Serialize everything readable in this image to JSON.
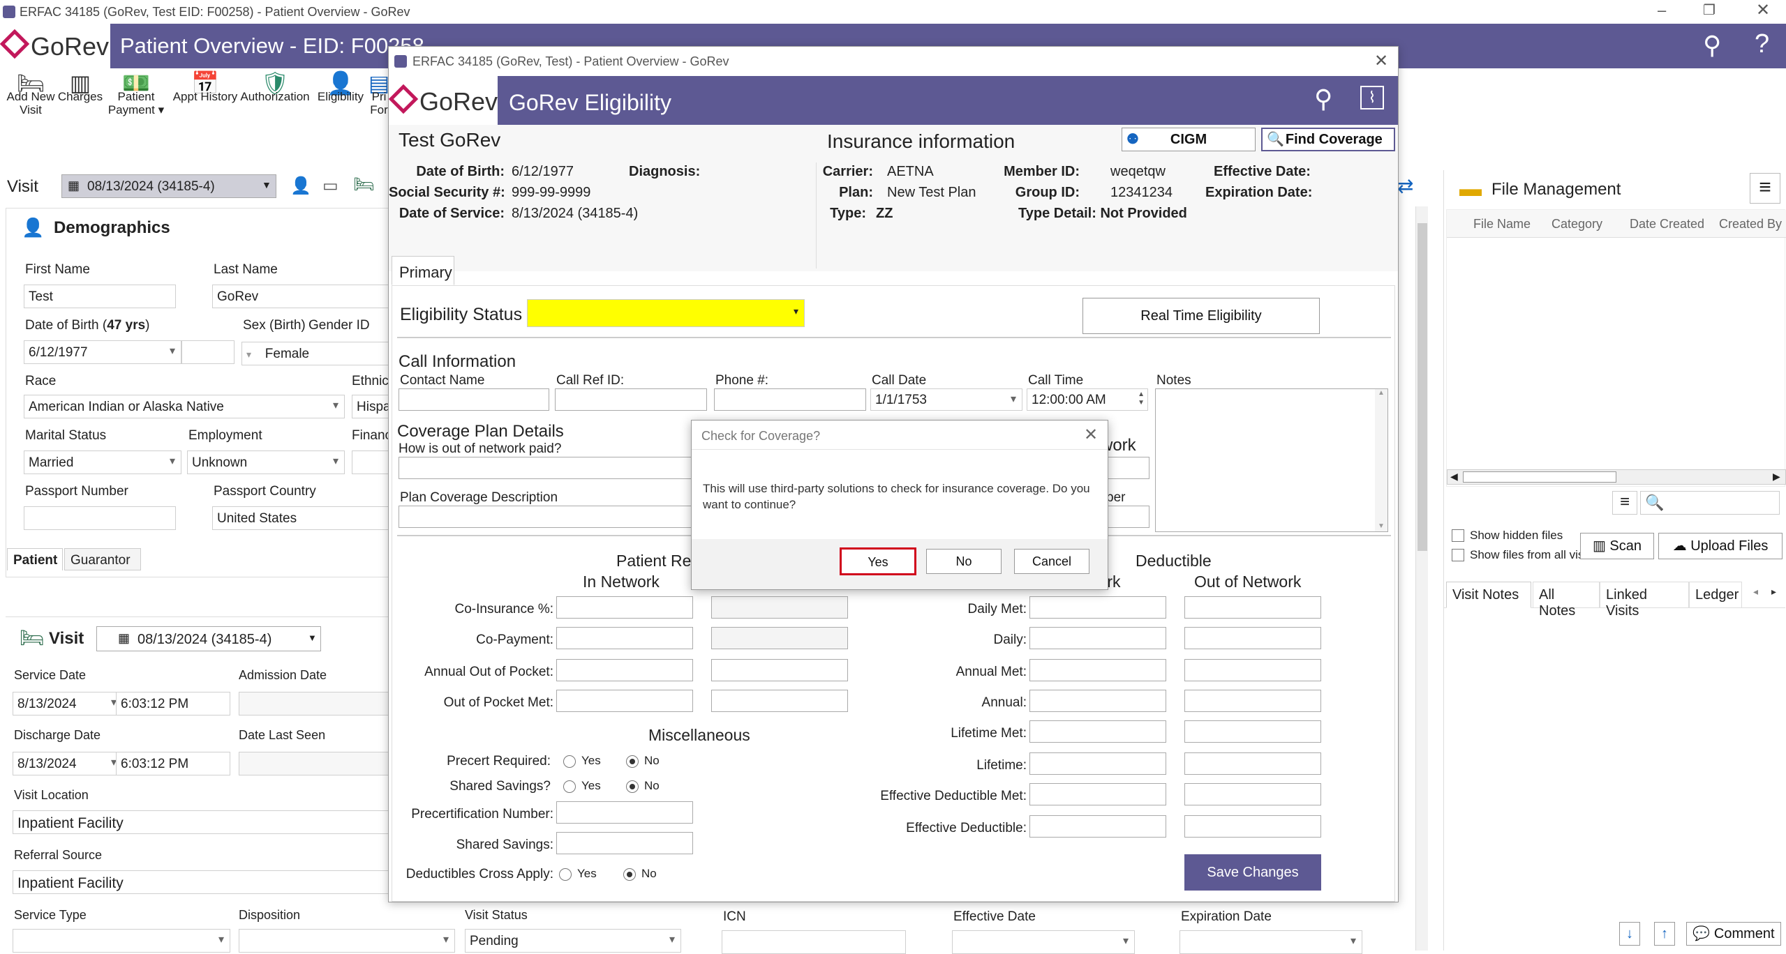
{
  "os_title": "ERFAC 34185 (GoRev, Test EID: F00258) - Patient Overview - GoRev",
  "main": {
    "logo": "GoRev",
    "title": "Patient Overview - EID: F00258"
  },
  "toolbar": [
    "Add New Visit",
    "Charges",
    "Patient Payment",
    "Appt History",
    "Authorization",
    "Eligibility",
    "Pri",
    "For"
  ],
  "visit_bar": {
    "label": "Visit",
    "value": "08/13/2024 (34185-4)"
  },
  "demographics": {
    "title": "Demographics",
    "first_name_label": "First Name",
    "first_name": "Test",
    "last_name_label": "Last Name",
    "last_name": "GoRev",
    "dob_label": "Date of Birth (",
    "dob_age": "47 yrs",
    "dob_close": ")",
    "dob": "6/12/1977",
    "sex_label": "Sex (Birth)",
    "gender_label": "Gender ID",
    "gender": "Female",
    "race_label": "Race",
    "race": "American Indian or Alaska Native",
    "ethnic_label": "Ethnic",
    "ethnic": "Hispa",
    "marital_label": "Marital Status",
    "marital": "Married",
    "employment_label": "Employment",
    "employment": "Unknown",
    "finance_label": "Financ",
    "passport_label": "Passport Number",
    "passport_country_label": "Passport Country",
    "passport_country": "United States",
    "tabs": [
      "Patient",
      "Guarantor"
    ]
  },
  "visit_panel": {
    "title": "Visit",
    "select": "08/13/2024 (34185-4)",
    "service_date_label": "Service Date",
    "service_date": "8/13/2024",
    "service_time": "6:03:12 PM",
    "admission_label": "Admission Date",
    "discharge_label": "Discharge Date",
    "discharge_date": "8/13/2024",
    "discharge_time": "6:03:12 PM",
    "last_seen_label": "Date Last Seen",
    "location_label": "Visit Location",
    "location": "Inpatient Facility",
    "referral_label": "Referral Source",
    "referral": "Inpatient Facility",
    "service_type_label": "Service Type",
    "disposition_label": "Disposition",
    "status_label": "Visit Status",
    "status": "Pending",
    "icn_label": "ICN",
    "eff_label": "Effective Date",
    "exp_label": "Expiration Date"
  },
  "files": {
    "title": "File Management",
    "columns": [
      "File Name",
      "Category",
      "Date Created",
      "Created By"
    ],
    "show_hidden": "Show hidden files",
    "show_all": "Show files from all visits",
    "scan": "Scan",
    "upload": "Upload Files",
    "note_tabs": [
      "Visit Notes",
      "All Notes",
      "Linked Visits",
      "Ledger"
    ],
    "comment": "Comment"
  },
  "elig": {
    "window_title": "ERFAC 34185 (GoRev, Test) - Patient Overview - GoRev",
    "logo": "GoRev",
    "title": "GoRev Eligibility",
    "patient_name": "Test GoRev",
    "dob_label": "Date of Birth:",
    "dob": "6/12/1977",
    "diag_label": "Diagnosis:",
    "ssn_label": "Social Security #:",
    "ssn": "999-99-9999",
    "dos_label": "Date of Service:",
    "dos": "8/13/2024 (34185-4)",
    "ins_title": "Insurance information",
    "cigm": "CIGM",
    "find_coverage": "Find Coverage",
    "carrier_label": "Carrier:",
    "carrier": "AETNA",
    "plan_label": "Plan:",
    "plan": "New Test Plan",
    "type_label": "Type:",
    "type": "ZZ",
    "member_label": "Member ID:",
    "member": "weqetqw",
    "group_label": "Group ID:",
    "group": "12341234",
    "type_detail_label": "Type Detail:",
    "type_detail": "Not Provided",
    "eff_label": "Effective Date:",
    "exp_label": "Expiration Date:",
    "tab": "Primary",
    "status_label": "Eligibility Status",
    "rte": "Real Time Eligibility",
    "call_title": "Call Information",
    "contact_label": "Contact Name",
    "callref_label": "Call Ref ID:",
    "phone_label": "Phone #:",
    "calldate_label": "Call Date",
    "calldate": "1/1/1753",
    "calltime_label": "Call Time",
    "calltime": "12:00:00 AM",
    "notes_label": "Notes",
    "coverage_title": "Coverage Plan Details",
    "oon_label": "How is out of network paid?",
    "plan_desc_label": "Plan Coverage Description",
    "network_frag": "work",
    "number_frag": "ber",
    "resp_title": "Patient Re",
    "in_network": "In Network",
    "deductible_title": "Deductible",
    "network_frag2": "work",
    "out_network": "Out of Network",
    "coins_label": "Co-Insurance %:",
    "copay_label": "Co-Payment:",
    "annual_oop_label": "Annual Out of Pocket:",
    "oop_met_label": "Out of Pocket Met:",
    "daily_met_label": "Daily Met:",
    "daily_label": "Daily:",
    "annual_met_label": "Annual Met:",
    "annual_label": "Annual:",
    "lifetime_met_label": "Lifetime Met:",
    "lifetime_label": "Lifetime:",
    "eff_ded_met_label": "Effective Deductible Met:",
    "eff_ded_label": "Effective Deductible:",
    "misc_title": "Miscellaneous",
    "precert_label": "Precert Required:",
    "shared_label": "Shared Savings?",
    "precert_num_label": "Precertification Number:",
    "shared_amt_label": "Shared Savings:",
    "ded_cross_label": "Deductibles Cross Apply:",
    "yes": "Yes",
    "no": "No",
    "save": "Save Changes"
  },
  "dialog": {
    "title": "Check for Coverage?",
    "message": "This will use third-party solutions to check for insurance coverage. Do you want to continue?",
    "yes": "Yes",
    "no": "No",
    "cancel": "Cancel"
  },
  "colors": {
    "header": "#5d5993",
    "highlight": "#ffff00",
    "focus_border": "#d0021b"
  }
}
